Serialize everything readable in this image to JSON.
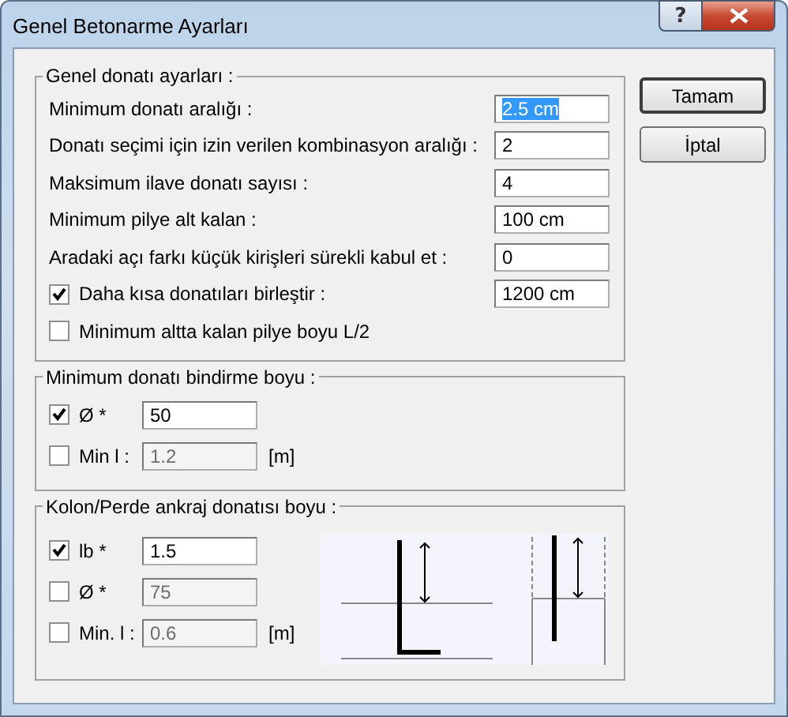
{
  "window": {
    "title": "Genel Betonarme Ayarları",
    "help_button": "?"
  },
  "general": {
    "title": "Genel donatı ayarları :",
    "rows": [
      {
        "kind": "input",
        "label": "Minimum donatı aralığı :",
        "value": "2.5 cm",
        "highlighted": true
      },
      {
        "kind": "input",
        "label": "Donatı seçimi için izin verilen kombinasyon aralığı :",
        "value": "2",
        "highlighted": false
      },
      {
        "kind": "input",
        "label": "Maksimum ilave donatı sayısı :",
        "value": "4",
        "highlighted": false
      },
      {
        "kind": "input",
        "label": "Minimum pilye alt kalan :",
        "value": "100 cm",
        "highlighted": false
      },
      {
        "kind": "input",
        "label": "Aradaki açı farkı küçük kirişleri sürekli kabul et :",
        "value": "0",
        "highlighted": false
      },
      {
        "kind": "checkbox",
        "label": "Daha kısa donatıları birleştir :",
        "checked": true,
        "value": "1200 cm"
      },
      {
        "kind": "checkbox",
        "label": "Minimum altta kalan pilye boyu L/2",
        "checked": false
      }
    ]
  },
  "lap": {
    "title": "Minimum donatı bindirme boyu :",
    "rows": [
      {
        "label": "Ø *",
        "checked": true,
        "value": "50",
        "disabled": false
      },
      {
        "label": "Min l :",
        "checked": false,
        "value": "1.2",
        "disabled": true,
        "unit": "[m]"
      }
    ]
  },
  "anchorage": {
    "title": "Kolon/Perde ankraj donatısı boyu :",
    "rows": [
      {
        "label": "lb *",
        "checked": true,
        "value": "1.5",
        "disabled": false
      },
      {
        "label": "Ø *",
        "checked": false,
        "value": "75",
        "disabled": true
      },
      {
        "label": "Min. l :",
        "checked": false,
        "value": "0.6",
        "disabled": true,
        "unit": "[m]"
      }
    ]
  },
  "buttons": [
    {
      "label": "Tamam",
      "default": true
    },
    {
      "label": "İptal",
      "default": false
    }
  ]
}
